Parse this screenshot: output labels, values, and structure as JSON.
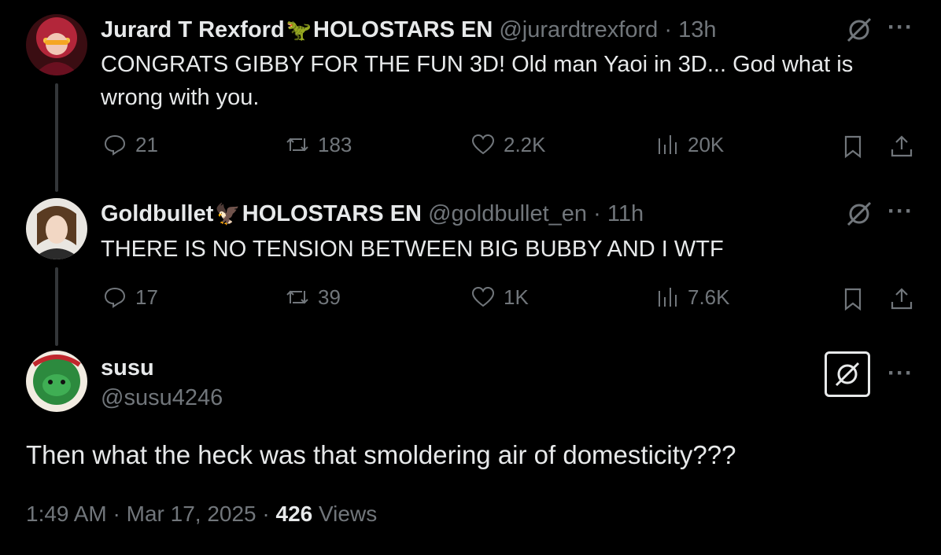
{
  "tweets": [
    {
      "name": "Jurard T Rexford",
      "emoji": "🦖",
      "affiliation": "HOLOSTARS EN",
      "handle": "@jurardtrexford",
      "time": "13h",
      "text_line1": "CONGRATS GIBBY FOR THE FUN 3D! Old man Yaoi in 3D... God what is",
      "text_line2": "wrong with you.",
      "replies": "21",
      "reposts": "183",
      "likes": "2.2K",
      "views": "20K"
    },
    {
      "name": "Goldbullet",
      "emoji": "🦅",
      "affiliation": "HOLOSTARS EN",
      "handle": "@goldbullet_en",
      "time": "11h",
      "text_line1": "THERE IS NO TENSION BETWEEN BIG BUBBY AND I WTF",
      "replies": "17",
      "reposts": "39",
      "likes": "1K",
      "views": "7.6K"
    }
  ],
  "main_tweet": {
    "name": "susu",
    "handle": "@susu4246",
    "text": "Then what the heck was that smoldering air of domesticity???",
    "time": "1:49 AM",
    "date": "Mar 17, 2025",
    "views_count": "426",
    "views_label": "Views"
  },
  "separator": "·",
  "more_glyph": "···",
  "icons": [
    "reply-icon",
    "repost-icon",
    "like-icon",
    "views-icon",
    "bookmark-icon",
    "share-icon",
    "grok-icon",
    "more-icon"
  ],
  "colors": {
    "background": "#000000",
    "text": "#e7e9ea",
    "muted": "#71767b",
    "thread_line": "#333639"
  }
}
